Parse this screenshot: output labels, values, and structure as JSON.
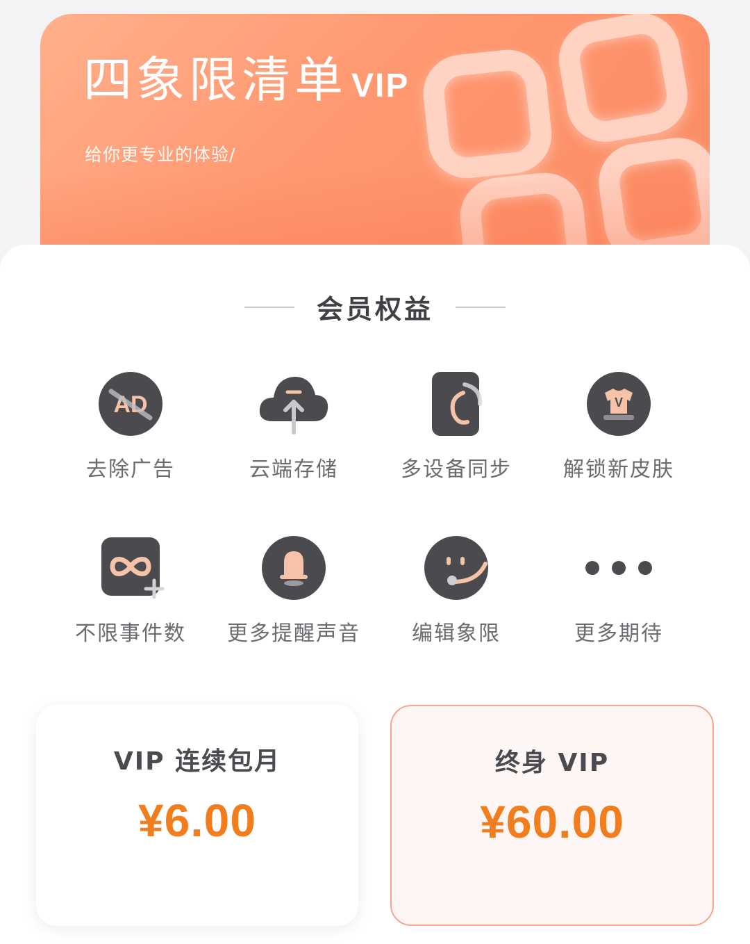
{
  "banner": {
    "title": "四象限清单",
    "title_suffix": "VIP",
    "subtitle": "给你更专业的体验/"
  },
  "section": {
    "title": "会员权益"
  },
  "benefits": [
    {
      "label": "去除广告",
      "icon": "ad-block-icon"
    },
    {
      "label": "云端存储",
      "icon": "cloud-upload-icon"
    },
    {
      "label": "多设备同步",
      "icon": "device-sync-icon"
    },
    {
      "label": "解锁新皮肤",
      "icon": "skin-shirt-icon"
    },
    {
      "label": "不限事件数",
      "icon": "infinity-icon"
    },
    {
      "label": "更多提醒声音",
      "icon": "bell-icon"
    },
    {
      "label": "编辑象限",
      "icon": "edit-face-icon"
    },
    {
      "label": "更多期待",
      "icon": "more-dots-icon"
    }
  ],
  "plans": [
    {
      "name": "VIP 连续包月",
      "price": "¥6.00",
      "selected": false
    },
    {
      "name": "终身 VIP",
      "price": "¥60.00",
      "selected": true
    }
  ],
  "colors": {
    "banner": "#fb8a62",
    "price": "#f07d1e",
    "icon_dark": "#4a4a4f",
    "icon_accent": "#f6c3a8",
    "selected_border": "#f4a790"
  }
}
